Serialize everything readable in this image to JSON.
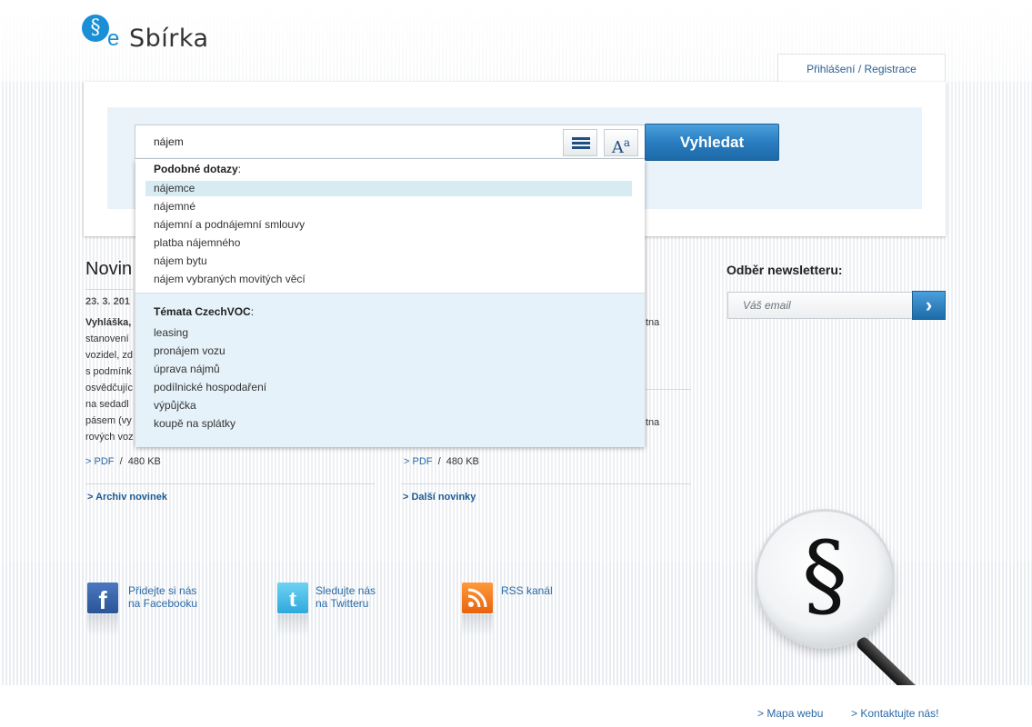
{
  "logo": {
    "mark": "§",
    "e": "e",
    "name": "Sbírka"
  },
  "header": {
    "login_link": "Přihlášení / Registrace"
  },
  "search": {
    "query": "nájem",
    "button": "Vyhledat",
    "tool_list_icon": "list-icon",
    "tool_font_icon": "font-size-icon",
    "tool_font_glyph_big": "A",
    "tool_font_glyph_small": "a"
  },
  "suggestions": {
    "similar_title": "Podobné dotazy",
    "similar": [
      "nájemce",
      "nájemné",
      "nájemní a podnájemní smlouvy",
      "platba nájemného",
      "nájem bytu",
      "nájem vybraných movitých věcí"
    ],
    "themes_title": "Témata CzechVOC",
    "themes": [
      "leasing",
      "pronájem vozu",
      "úprava nájmů",
      "podílnické hospodaření",
      "výpůjčka",
      "koupě na splátky"
    ]
  },
  "news": {
    "title": "Novin",
    "date": "23. 3. 201",
    "left_lines": [
      "Vyhláška,",
      "stanovení",
      "vozidel, zd",
      "s podmínk",
      "osvědčujíc",
      "na sedadl",
      "pásem (vy",
      "rových voz"
    ],
    "right_fragments": [
      "tna",
      "tna"
    ],
    "pdf_label": "PDF",
    "pdf_size": "480 KB",
    "archive_link": "Archiv novinek",
    "more_link": "Další novinky"
  },
  "newsletter": {
    "title": "Odběr newsletteru:",
    "placeholder": "Váš email",
    "submit_icon": "chevron-right-icon",
    "submit_glyph": "›"
  },
  "social": {
    "facebook": {
      "icon": "facebook-icon",
      "glyph": "f",
      "line1": "Přidejte si nás",
      "line2": "na Facebooku"
    },
    "twitter": {
      "icon": "twitter-icon",
      "glyph": "t",
      "line1": "Sledujte nás",
      "line2": "na Twitteru"
    },
    "rss": {
      "icon": "rss-icon",
      "line1": "RSS kanál"
    }
  },
  "footer": {
    "sitemap": "Mapa webu",
    "contact": "Kontaktujte nás!"
  },
  "decoration": {
    "magnifier_symbol": "§"
  },
  "colors": {
    "accent": "#1a8fd6",
    "link": "#2b6aa6",
    "button": "#2a7dc0",
    "highlight": "#d7ebf3"
  }
}
